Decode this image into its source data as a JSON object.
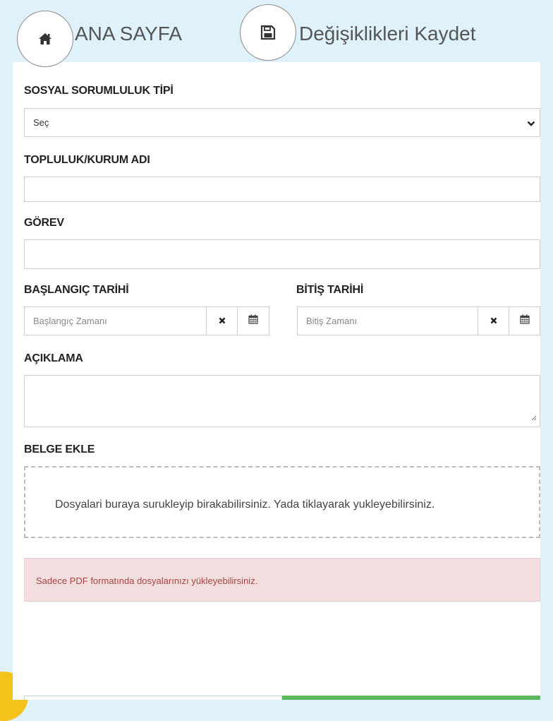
{
  "topbar": {
    "home_label": "ANA SAYFA",
    "save_label": "Değişiklikleri Kaydet"
  },
  "form": {
    "type": {
      "label": "SOSYAL SORUMLULUK TİPİ",
      "selected": "Seç"
    },
    "org": {
      "label": "TOPLULUK/KURUM ADI",
      "value": ""
    },
    "role": {
      "label": "GÖREV",
      "value": ""
    },
    "start": {
      "label": "BAŞLANGIÇ TARİHİ",
      "placeholder": "Başlangıç Zamanı"
    },
    "end": {
      "label": "BİTİŞ TARİHİ",
      "placeholder": "Bitiş Zamanı"
    },
    "desc": {
      "label": "AÇIKLAMA",
      "value": ""
    },
    "attach": {
      "label": "BELGE EKLE",
      "dropzone_text": "Dosyalari buraya surukleyip birakabilirsiniz. Yada tiklayarak yukleyebilirsiniz."
    },
    "alert": "Sadece PDF formatında dosyalarınızı yükleyebilirsiniz."
  },
  "icons": {
    "home": "home-icon",
    "save": "floppy-disk-icon",
    "clear": "times-icon",
    "calendar": "calendar-icon",
    "dropdown": "chevron-down-icon"
  },
  "colors": {
    "background": "#dff1fb",
    "alert_bg": "#f2dede",
    "alert_text": "#a94442",
    "success": "#5cb85c",
    "accent": "#f4c21b"
  }
}
